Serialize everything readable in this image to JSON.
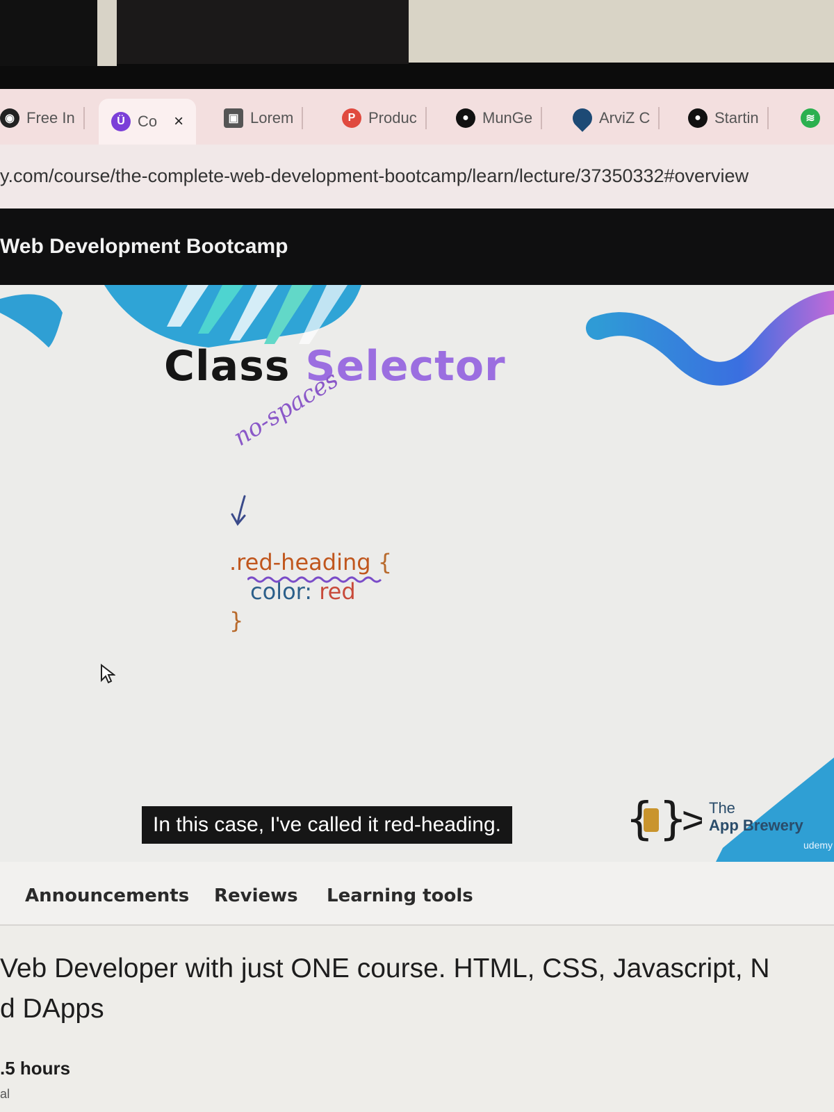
{
  "browser": {
    "tabs": [
      {
        "label": "Free In",
        "icon": "openai-icon",
        "active": false
      },
      {
        "label": "Co",
        "icon": "udemy-icon",
        "active": true,
        "close": "×"
      },
      {
        "label": "Lorem",
        "icon": "image-icon",
        "active": false
      },
      {
        "label": "Produc",
        "icon": "product-hunt-icon",
        "active": false
      },
      {
        "label": "MunGe",
        "icon": "github-icon",
        "active": false
      },
      {
        "label": "ArviZ C",
        "icon": "arviz-icon",
        "active": false
      },
      {
        "label": "Startin",
        "icon": "github-icon",
        "active": false
      },
      {
        "label": "",
        "icon": "spotify-icon",
        "active": false
      }
    ],
    "url": "y.com/course/the-complete-web-development-bootcamp/learn/lecture/37350332#overview"
  },
  "course": {
    "header_title": "Web Development Bootcamp"
  },
  "video": {
    "slide_title_1": "Class",
    "slide_title_2": "Selector",
    "annotation": "no-spaces",
    "code": {
      "selector": ".red-heading",
      "open_brace": "{",
      "property": "color:",
      "value": "red",
      "close_brace": "}"
    },
    "caption": "In this case, I've called it red-heading.",
    "brand_line1": "The",
    "brand_line2": "App Brewery",
    "watermark": "udemy"
  },
  "lecture_tabs": [
    "Announcements",
    "Reviews",
    "Learning tools"
  ],
  "description": {
    "line1": "Veb Developer with just ONE course. HTML, CSS, Javascript, N",
    "line2": "d DApps",
    "hours": ".5 hours",
    "sub": "al"
  },
  "colors": {
    "accent_purple": "#9b6ee0",
    "caption_bg": "#161616",
    "header_bg": "#0f0f10"
  }
}
